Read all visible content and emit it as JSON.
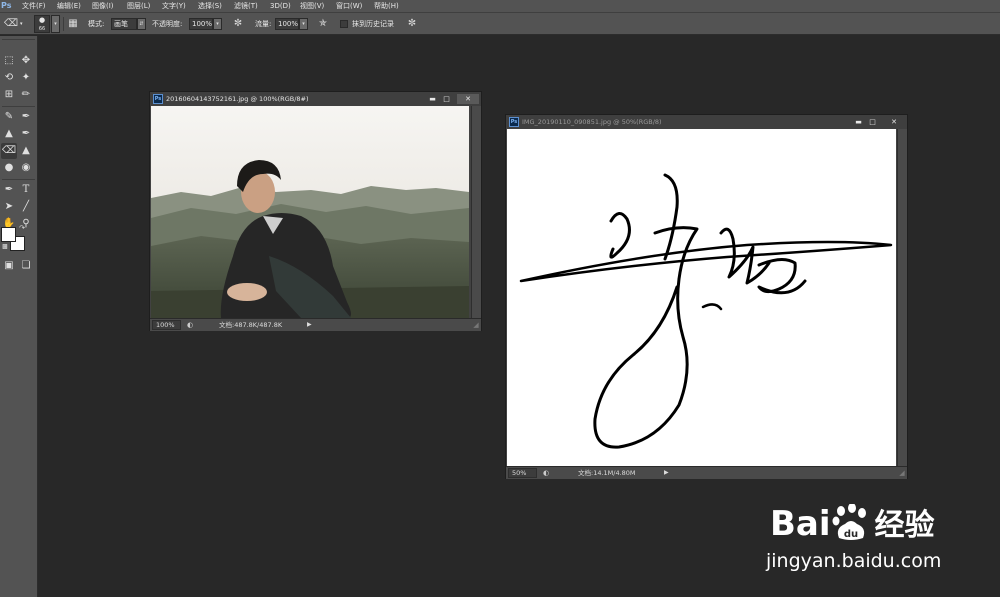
{
  "menubar": {
    "logo": "Ps",
    "items": [
      "文件(F)",
      "编辑(E)",
      "图像(I)",
      "图层(L)",
      "文字(Y)",
      "选择(S)",
      "滤镜(T)",
      "3D(D)",
      "视图(V)",
      "窗口(W)",
      "帮助(H)"
    ]
  },
  "options": {
    "brush_size": "66",
    "mode_label": "模式:",
    "mode_value": "画笔",
    "opacity_label": "不透明度:",
    "opacity_value": "100%",
    "flow_label": "流量:",
    "flow_value": "100%",
    "history_label": "抹到历史记录"
  },
  "documents": [
    {
      "icon": "Ps",
      "title": "20160604143752161.jpg @ 100%(RGB/8#)",
      "zoom": "100%",
      "doc_info": "文档:487.8K/487.8K"
    },
    {
      "icon": "Ps",
      "title": "IMG_20190110_090851.jpg @ 50%(RGB/8)",
      "zoom": "50%",
      "doc_info": "文档:14.1M/4.80M"
    }
  ],
  "watermark": {
    "brand": "Bai",
    "brand2": "du",
    "product": "经验",
    "url": "jingyan.baidu.com"
  },
  "colors": {
    "workspace": "#282828",
    "panel": "#535353",
    "canvas": "#ffffff",
    "watermark": "#ffffff"
  }
}
